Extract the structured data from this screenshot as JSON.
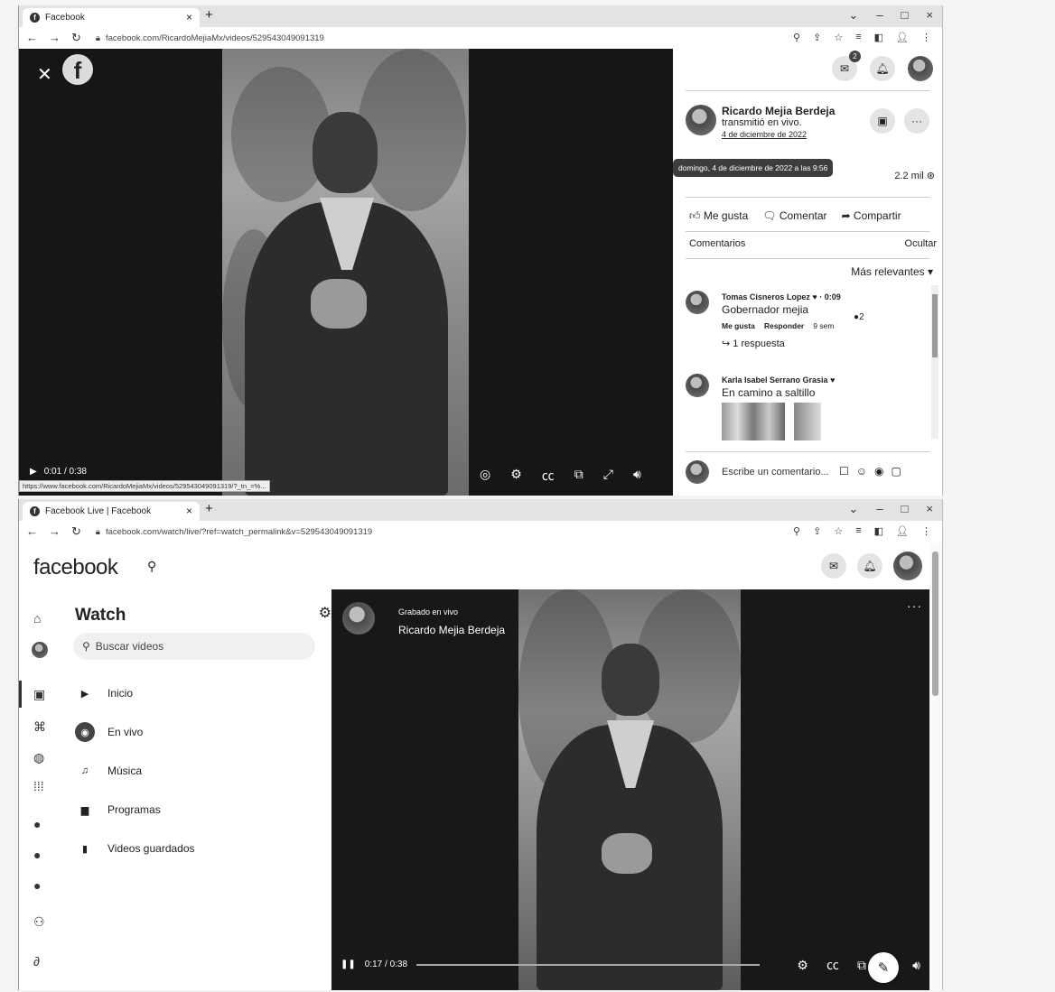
{
  "shot1": {
    "tab_title": "Facebook",
    "url": "facebook.com/RicardoMejiaMx/videos/529543049091319",
    "video_time": "0:01 / 0:38",
    "status_url": "https://www.facebook.com/RicardoMejiaMx/videos/529543049091319/?_tn_=%...",
    "messenger_badge": "2",
    "poster_name": "Ricardo Mejia Berdeja",
    "poster_subtitle": "transmitió en vivo.",
    "post_date": "4 de diciembre de 2022",
    "tooltip": "domingo, 4 de diciembre de 2022 a las 9:56",
    "views": "2.2 mil",
    "like_label": "Me gusta",
    "comment_label": "Comentar",
    "share_label": "Compartir",
    "comments_heading": "Comentarios",
    "hide_label": "Ocultar",
    "sort_label": "Más relevantes",
    "comments": [
      {
        "name": "Tomas Cisneros Lopez",
        "time": "· 0:09",
        "text": "Gobernador mejia",
        "reactions": "2",
        "like": "Me gusta",
        "reply": "Responder",
        "age": "9 sem",
        "replies": "↪ 1 respuesta"
      },
      {
        "name": "Karla Isabel Serrano Grasia",
        "text": "En camino a saltillo"
      }
    ],
    "write_placeholder": "Escribe un comentario..."
  },
  "shot2": {
    "tab_title": "Facebook Live | Facebook",
    "url": "facebook.com/watch/live/?ref=watch_permalink&v=529543049091319",
    "logo": "facebook",
    "watch_title": "Watch",
    "search_placeholder": "Buscar videos",
    "nav": [
      {
        "label": "Inicio",
        "icon": "play-icon"
      },
      {
        "label": "En vivo",
        "icon": "live-icon"
      },
      {
        "label": "Música",
        "icon": "music-icon"
      },
      {
        "label": "Programas",
        "icon": "shows-icon"
      },
      {
        "label": "Videos guardados",
        "icon": "bookmark-icon"
      }
    ],
    "live_label": "Grabado en vivo",
    "live_name": "Ricardo Mejia Berdeja",
    "video_time": "0:17 / 0:38"
  }
}
